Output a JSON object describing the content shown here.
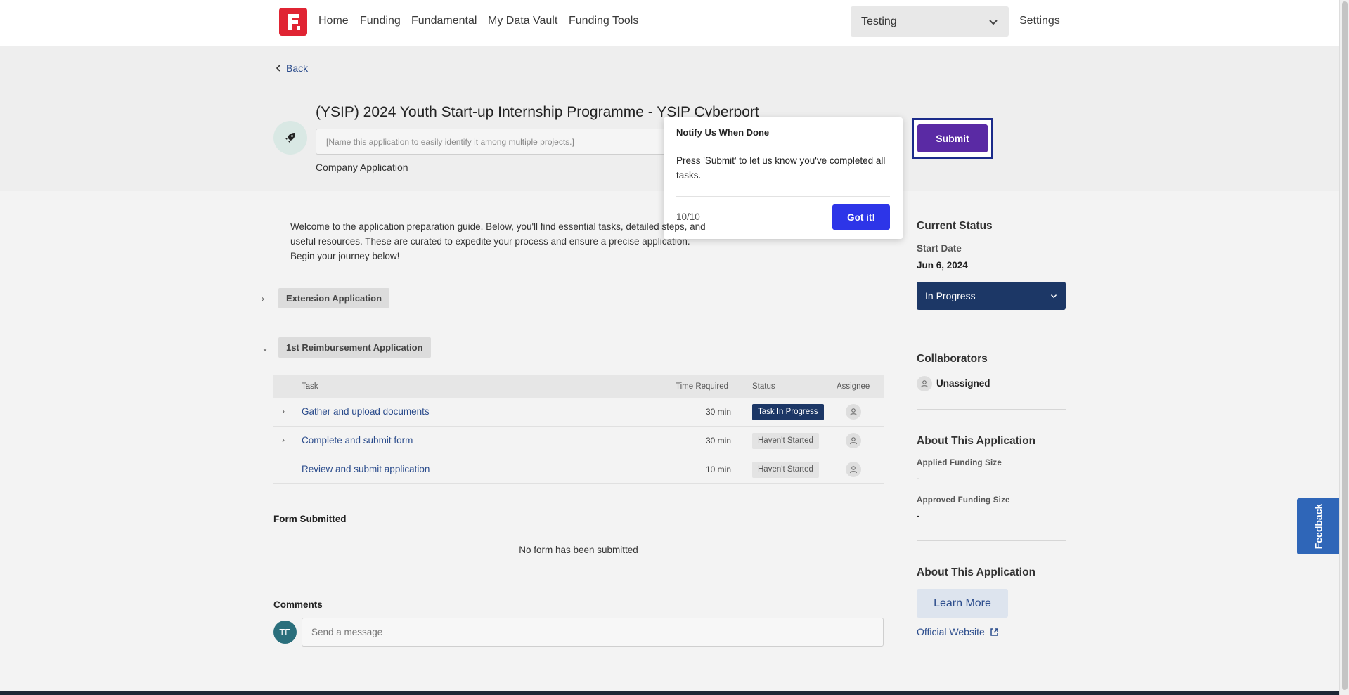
{
  "nav": {
    "links": [
      "Home",
      "Funding",
      "Fundamental",
      "My Data Vault",
      "Funding Tools"
    ],
    "workspace": "Testing",
    "settings": "Settings"
  },
  "header": {
    "back": "Back",
    "title": "(YSIP) 2024 Youth Start-up Internship Programme - YSIP Cyberport",
    "nickname_placeholder": "[Name this application to easily identify it among multiple projects.]",
    "type": "Company Application",
    "submit": "Submit"
  },
  "popover": {
    "title": "Notify Us When Done",
    "body": "Press 'Submit' to let us know you've completed all tasks.",
    "step": "10/10",
    "button": "Got it!"
  },
  "welcome": "Welcome to the application preparation guide. Below, you'll find essential tasks, detailed steps, and useful resources. These are curated to expedite your process and ensure a precise application. Begin your journey below!",
  "sections": [
    {
      "label": "Extension Application",
      "arrow": "›"
    },
    {
      "label": "1st Reimbursement Application",
      "arrow": "⌄"
    }
  ],
  "table": {
    "headers": {
      "task": "Task",
      "time": "Time Required",
      "status": "Status",
      "assignee": "Assignee"
    },
    "rows": [
      {
        "expand": "›",
        "name": "Gather and upload documents",
        "time": "30 min",
        "status": "Task In Progress"
      },
      {
        "expand": "›",
        "name": "Complete and submit form",
        "time": "30 min",
        "status": "Haven't Started"
      },
      {
        "expand": "",
        "name": "Review and submit application",
        "time": "10 min",
        "status": "Haven't Started"
      }
    ]
  },
  "form": {
    "label": "Form Submitted",
    "empty": "No form has been submitted"
  },
  "comments": {
    "label": "Comments",
    "avatar": "TE",
    "placeholder": "Send a message"
  },
  "sidebar": {
    "status_heading": "Current Status",
    "start_label": "Start Date",
    "start_value": "Jun 6, 2024",
    "status_value": "In Progress",
    "collab_heading": "Collaborators",
    "collab_value": "Unassigned",
    "about_heading": "About This Application",
    "applied_label": "Applied Funding Size",
    "applied_value": "-",
    "approved_label": "Approved Funding Size",
    "approved_value": "-",
    "about_heading_2": "About This Application",
    "learn_more": "Learn More",
    "official": "Official Website"
  },
  "feedback": "Feedback",
  "colors": {
    "brand_red": "#e02433",
    "submit_purple": "#5a2aa4",
    "popover_button": "#2d35e8",
    "status_navy": "#1c3766",
    "link_blue": "#2b4c8c",
    "feedback_blue": "#2f66b8"
  },
  "icons": [
    "logo-icon",
    "chevron-down-icon",
    "chevron-left-icon",
    "rocket-icon",
    "user-icon",
    "external-link-icon"
  ]
}
